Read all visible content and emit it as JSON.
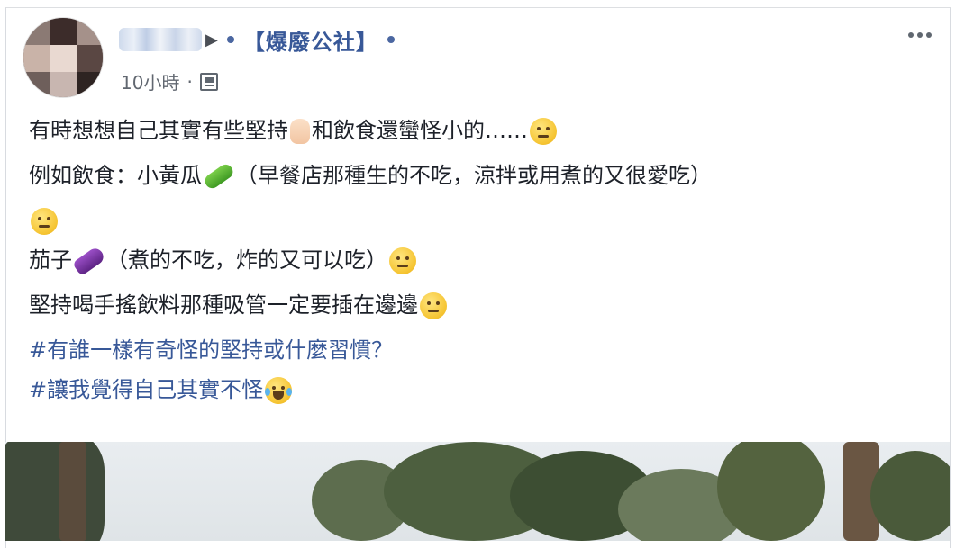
{
  "post": {
    "author": {
      "name_blurred": "",
      "arrow": "▶"
    },
    "group": "【爆廢公社】",
    "time": "10小時",
    "separator": "·",
    "privacy_icon": "public-group-icon",
    "menu_icon": "more-options-icon"
  },
  "content": {
    "lines": [
      {
        "before": "有時想想自己其實有些堅持",
        "middle": "和飲食還蠻怪小的……",
        "emoji1": "hand-emoji",
        "emoji2": "thinking-emoji"
      },
      {
        "text": "例如飲食：小黃瓜",
        "rest": "（早餐店那種生的不吃，涼拌或用煮的又很愛吃）",
        "emoji": "cucumber-emoji"
      },
      {
        "emoji": "neutral-face-emoji"
      },
      {
        "text": "茄子",
        "rest": "（煮的不吃，炸的又可以吃）",
        "emoji1": "eggplant-emoji",
        "emoji2": "unamused-face-emoji"
      },
      {
        "text": "堅持喝手搖飲料那種吸管一定要插在邊邊",
        "emoji": "unamused-face-emoji"
      }
    ],
    "hashtags": [
      {
        "text": "#有誰一樣有奇怪的堅持或什麼習慣？"
      },
      {
        "text": "#讓我覺得自己其實不怪",
        "emoji": "laughing-tears-emoji"
      }
    ]
  },
  "colors": {
    "link": "#385898",
    "text": "#1d2129",
    "meta": "#616770"
  }
}
